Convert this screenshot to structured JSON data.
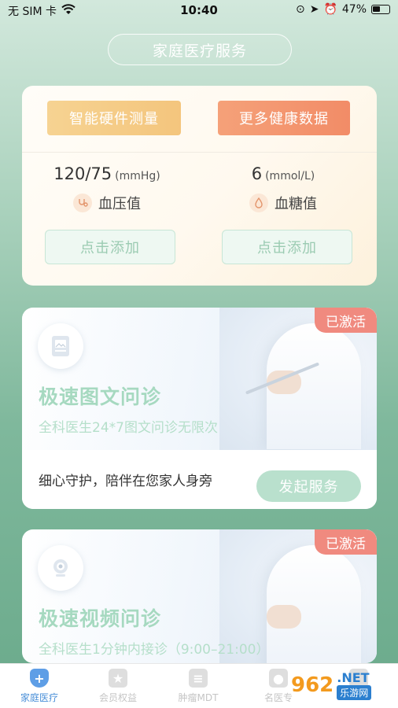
{
  "status_bar": {
    "carrier": "无 SIM 卡",
    "time": "10:40",
    "battery": "47%"
  },
  "header": {
    "title": "家庭医疗服务"
  },
  "health_card": {
    "hardware_button": "智能硬件测量",
    "more_data_button": "更多健康数据",
    "blood_pressure": {
      "value": "120/75",
      "unit": "(mmHg)",
      "label": "血压值",
      "add_label": "点击添加"
    },
    "blood_sugar": {
      "value": "6",
      "unit": "(mmol/L)",
      "label": "血糖值",
      "add_label": "点击添加"
    }
  },
  "services": [
    {
      "badge": "已激活",
      "title": "极速图文问诊",
      "subtitle": "全科医生24*7图文问诊无限次",
      "slogan": "细心守护，陪伴在您家人身旁",
      "action": "发起服务",
      "icon": "image-doc-icon"
    },
    {
      "badge": "已激活",
      "title": "极速视频问诊",
      "subtitle": "全科医生1分钟内接诊（9:00–21:00）",
      "icon": "video-camera-icon"
    }
  ],
  "tabs": [
    {
      "label": "家庭医疗",
      "active": true
    },
    {
      "label": "会员权益",
      "active": false
    },
    {
      "label": "肿瘤MDT",
      "active": false
    },
    {
      "label": "名医专",
      "active": false
    },
    {
      "label": "",
      "active": false
    }
  ],
  "watermark": {
    "logo": "962",
    "net": ".NET",
    "cn": "乐游网"
  },
  "colors": {
    "accent_green": "#a6d9c0",
    "badge_red": "#f08a7f",
    "tab_active": "#4a8fd8"
  }
}
